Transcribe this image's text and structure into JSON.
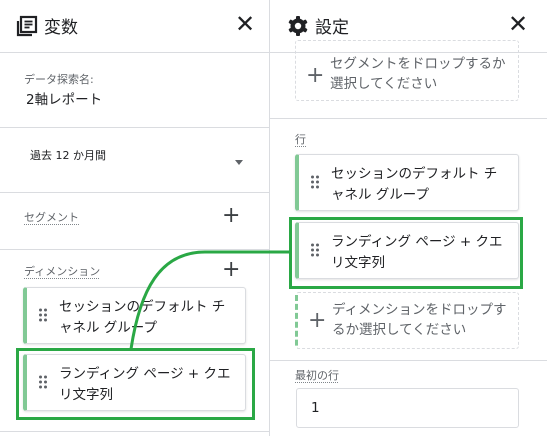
{
  "variables_panel": {
    "title": "変数",
    "icon": "variables-icon",
    "close_icon": "close-icon",
    "exploration_name_label": "データ探索名:",
    "exploration_name_value": "2軸レポート",
    "date_range_label": "過去 12 か月間",
    "segments_label": "セグメント",
    "dimensions_label": "ディメンション",
    "dimensions": [
      {
        "label": "セッションのデフォルト チャネル グループ"
      },
      {
        "label": "ランディング ページ + クエリ文字列"
      }
    ]
  },
  "settings_panel": {
    "title": "設定",
    "icon": "gear-icon",
    "close_icon": "close-icon",
    "segment_drop_text": "セグメントをドロップするか選択してください",
    "rows_label": "行",
    "rows": [
      {
        "label": "セッションのデフォルト チャネル グループ"
      },
      {
        "label": "ランディング ページ + クエリ文字列"
      }
    ],
    "dimension_drop_text": "ディメンションをドロップするか選択してください",
    "first_row_label": "最初の行",
    "first_row_value": "1"
  },
  "colors": {
    "highlight": "#2aa845",
    "chip_accent": "#81c995",
    "divider": "#dadce0"
  }
}
